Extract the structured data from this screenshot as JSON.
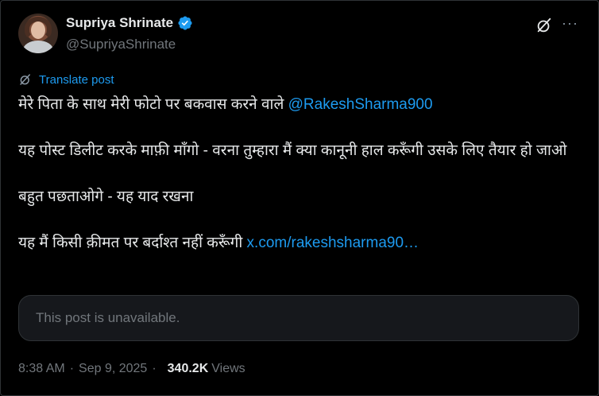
{
  "author": {
    "display_name": "Supriya Shrinate",
    "handle": "@SupriyaShrinate"
  },
  "actions": {
    "more": "···"
  },
  "translate": {
    "label": "Translate post"
  },
  "tweet": {
    "line1_text": "मेरे पिता के साथ मेरी फोटो पर बकवास करने वाले ",
    "line1_mention": "@RakeshSharma900",
    "para2": "यह पोस्ट डिलीट करके माफ़ी माँगो - वरना तुम्हारा मैं क्या कानूनी हाल करूँगी उसके लिए तैयार हो जाओ",
    "para3": "बहुत पछताओगे - यह याद रखना",
    "para4_text": "यह मैं किसी क़ीमत पर बर्दाश्त नहीं करूँगी ",
    "para4_link": "x.com/rakeshsharma90…"
  },
  "quoted": {
    "unavailable_text": "This post is unavailable."
  },
  "meta": {
    "time": "8:38 AM",
    "date": "Sep 9, 2025",
    "views_count": "340.2K",
    "views_label": "Views",
    "separator": "·"
  },
  "colors": {
    "background": "#000000",
    "text": "#e7e9ea",
    "muted": "#71767b",
    "accent": "#1d9bf0",
    "border": "#2f3336"
  },
  "icons": {
    "verified": "verified-badge-icon",
    "grok": "grok-icon",
    "more": "more-icon",
    "translate": "translate-icon"
  }
}
